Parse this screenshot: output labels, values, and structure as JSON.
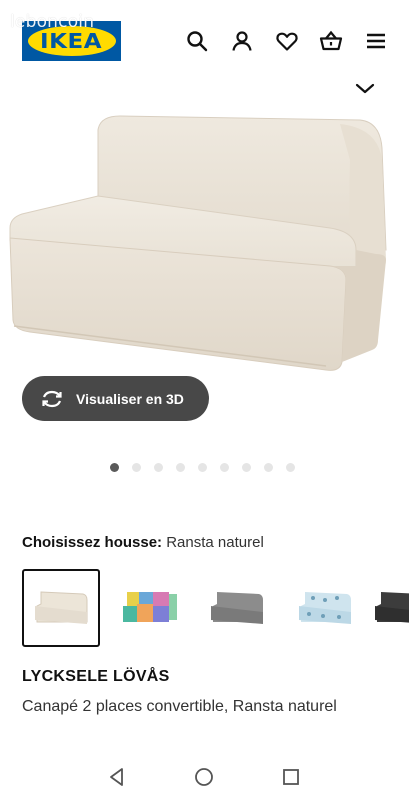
{
  "watermark": "leboncoin",
  "brand": {
    "logo_text": "IKEA",
    "blue": "#0058a3",
    "yellow": "#ffdb00"
  },
  "header_icons": [
    "search-icon",
    "user-icon",
    "heart-icon",
    "basket-icon",
    "menu-icon"
  ],
  "product": {
    "view_3d_label": "Visualiser en 3D",
    "gallery": {
      "count": 9,
      "active_index": 0
    },
    "cover": {
      "label": "Choisissez housse:",
      "selected": "Ransta naturel",
      "swatches": [
        "beige",
        "multicolor",
        "grey",
        "light-blue-pattern",
        "dark-grey"
      ]
    },
    "name": "LYCKSELE LÖVÅS",
    "description": "Canapé 2 places convertible, Ransta naturel"
  },
  "android_nav": [
    "back-icon",
    "home-icon",
    "recents-icon"
  ]
}
